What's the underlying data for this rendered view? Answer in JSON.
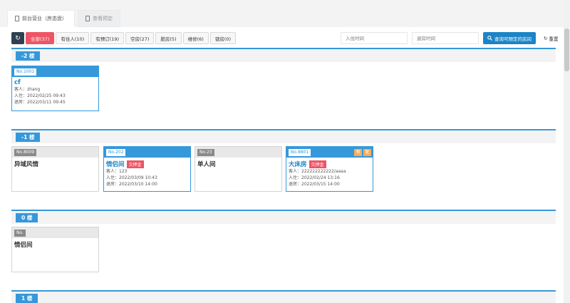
{
  "tabs": [
    {
      "label": "前台营业（房态盘）"
    },
    {
      "label": "查看预定"
    }
  ],
  "toolbar": {
    "refresh_glyph": "↻",
    "filters": [
      "全部(37)",
      "有住人(10)",
      "有预订(19)",
      "空房(27)",
      "脏房(5)",
      "维修(6)",
      "锁房(0)"
    ]
  },
  "search": {
    "checkin_placeholder": "入住时间",
    "checkout_placeholder": "退房时间",
    "query_label": "查询可预定的房间",
    "reset_label": "重置"
  },
  "floors": [
    {
      "label": "-2 楼"
    },
    {
      "label": "-1 楼"
    },
    {
      "label": "0 楼"
    },
    {
      "label": "1 楼"
    }
  ],
  "rooms": [
    {
      "no": "No.1001",
      "type": "cf",
      "guest": "客人：zhang",
      "checkin": "入住：2022/02/25 09:43",
      "checkout": "退房：2022/03/11 09:45"
    },
    {
      "no": "No.8009",
      "type": "异域风情"
    },
    {
      "no": "No.202",
      "type": "情侣间",
      "deposit": "欠押金",
      "guest": "客人：123",
      "checkin": "入住：2022/03/09 10:43",
      "checkout": "退房：2022/03/10 14:00"
    },
    {
      "no": "No.23",
      "type": "单人间"
    },
    {
      "no": "No.8801",
      "type": "大床房",
      "deposit": "欠押金",
      "guest": "客人：222222222222/aaaa",
      "checkin": "入住：2022/02/24 13:16",
      "checkout": "退房：2022/03/15 14:00",
      "tags": [
        "预",
        "脏"
      ]
    },
    {
      "no": "No.",
      "type": "情侣间"
    }
  ],
  "colors": {
    "accent": "#3598db",
    "danger": "#ed5565",
    "dark": "#2f4050",
    "primary": "#1c84c6"
  }
}
